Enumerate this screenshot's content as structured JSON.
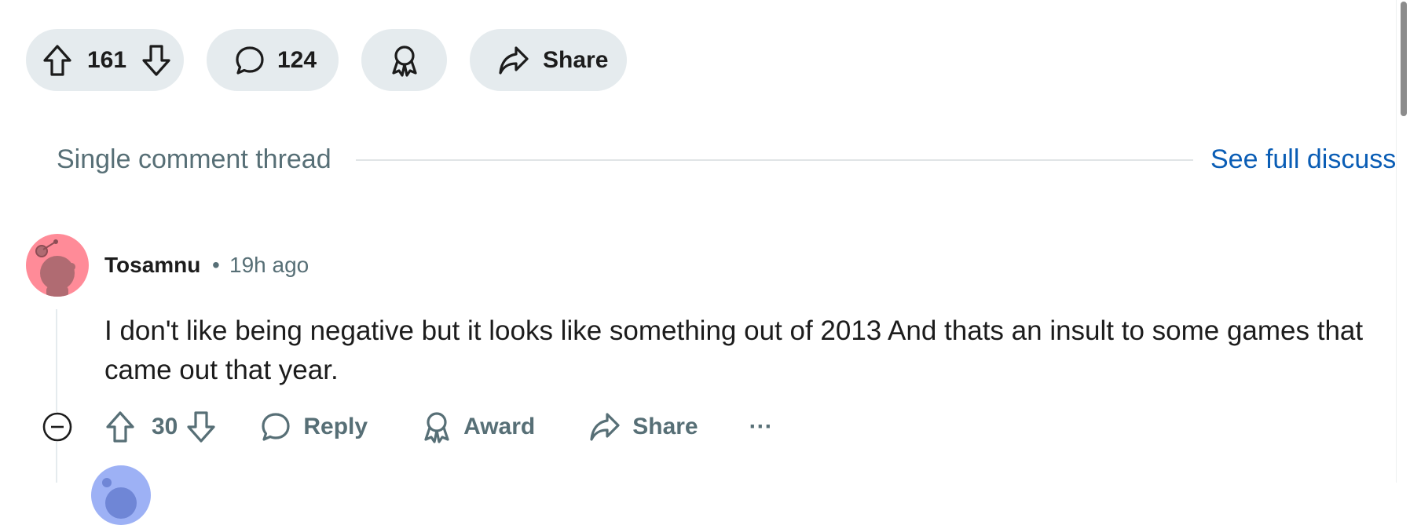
{
  "post_actions": {
    "vote_count": "161",
    "comment_count": "124",
    "share_label": "Share",
    "icons": [
      "upvote-icon",
      "downvote-icon",
      "comment-icon",
      "award-icon",
      "share-icon"
    ]
  },
  "thread": {
    "label": "Single comment thread",
    "see_full_label": "See full discussi"
  },
  "comment": {
    "author": "Tosamnu",
    "separator": "•",
    "time": "19h ago",
    "body": "I don't like being negative but it looks like something out of 2013 And thats an insult to some games that came out that year.",
    "vote_count": "30",
    "reply_label": "Reply",
    "award_label": "Award",
    "share_label": "Share",
    "more_label": "···"
  },
  "colors": {
    "pill_bg": "#e5ebee",
    "muted_text": "#576f76",
    "link": "#0a5db5",
    "avatar_bg": "#ff8b98",
    "child_avatar_bg": "#9db1f5"
  }
}
